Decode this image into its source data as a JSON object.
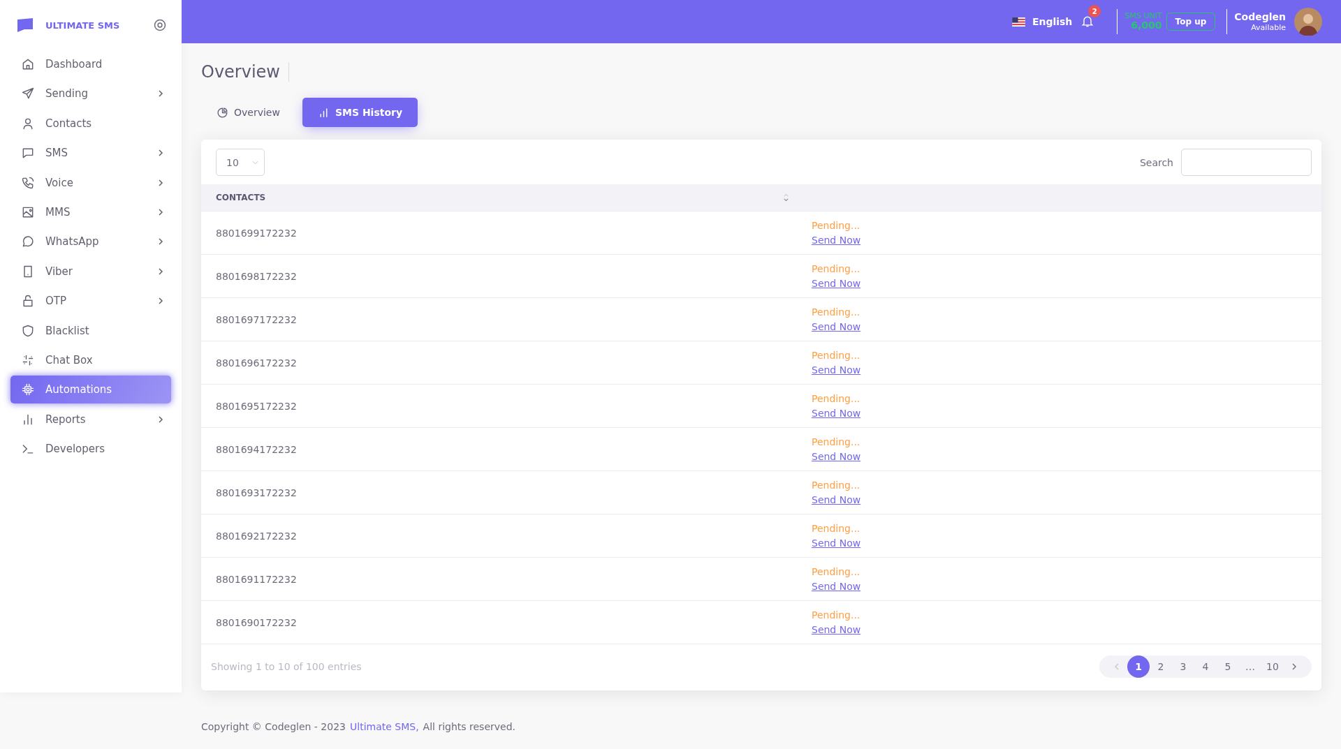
{
  "brand": {
    "name": "ULTIMATE SMS"
  },
  "sidebar": {
    "items": [
      {
        "label": "Dashboard",
        "expandable": false,
        "selected": false
      },
      {
        "label": "Sending",
        "expandable": true,
        "selected": false
      },
      {
        "label": "Contacts",
        "expandable": false,
        "selected": false
      },
      {
        "label": "SMS",
        "expandable": true,
        "selected": false
      },
      {
        "label": "Voice",
        "expandable": true,
        "selected": false
      },
      {
        "label": "MMS",
        "expandable": true,
        "selected": false
      },
      {
        "label": "WhatsApp",
        "expandable": true,
        "selected": false
      },
      {
        "label": "Viber",
        "expandable": true,
        "selected": false
      },
      {
        "label": "OTP",
        "expandable": true,
        "selected": false
      },
      {
        "label": "Blacklist",
        "expandable": false,
        "selected": false
      },
      {
        "label": "Chat Box",
        "expandable": false,
        "selected": false
      },
      {
        "label": "Automations",
        "expandable": false,
        "selected": true
      },
      {
        "label": "Reports",
        "expandable": true,
        "selected": false
      },
      {
        "label": "Developers",
        "expandable": false,
        "selected": false
      }
    ]
  },
  "header": {
    "language": "English",
    "notifications": "2",
    "sms_unit_label": "SMS UNIT",
    "sms_unit_value": "6,000",
    "top_up": "Top up",
    "user_name": "Codeglen",
    "user_status": "Available"
  },
  "page_title": "Overview",
  "tabs": [
    {
      "label": "Overview",
      "selected": false
    },
    {
      "label": "SMS History",
      "selected": true
    }
  ],
  "table": {
    "page_size": "10",
    "search_label": "Search",
    "columns": [
      "CONTACTS"
    ],
    "rows": [
      {
        "contact": "8801699172232",
        "status": "Pending...",
        "action": "Send Now"
      },
      {
        "contact": "8801698172232",
        "status": "Pending...",
        "action": "Send Now"
      },
      {
        "contact": "8801697172232",
        "status": "Pending...",
        "action": "Send Now"
      },
      {
        "contact": "8801696172232",
        "status": "Pending...",
        "action": "Send Now"
      },
      {
        "contact": "8801695172232",
        "status": "Pending...",
        "action": "Send Now"
      },
      {
        "contact": "8801694172232",
        "status": "Pending...",
        "action": "Send Now"
      },
      {
        "contact": "8801693172232",
        "status": "Pending...",
        "action": "Send Now"
      },
      {
        "contact": "8801692172232",
        "status": "Pending...",
        "action": "Send Now"
      },
      {
        "contact": "8801691172232",
        "status": "Pending...",
        "action": "Send Now"
      },
      {
        "contact": "8801690172232",
        "status": "Pending...",
        "action": "Send Now"
      }
    ],
    "info": "Showing 1 to 10 of 100 entries",
    "pages": [
      {
        "label": "1",
        "selected": true
      },
      {
        "label": "2",
        "selected": false
      },
      {
        "label": "3",
        "selected": false
      },
      {
        "label": "4",
        "selected": false
      },
      {
        "label": "5",
        "selected": false
      },
      {
        "label": "…",
        "selected": false
      },
      {
        "label": "10",
        "selected": false
      }
    ]
  },
  "footer": {
    "copyright": "Copyright © Codeglen - 2023",
    "link": "Ultimate SMS,",
    "rest": "All rights reserved."
  }
}
